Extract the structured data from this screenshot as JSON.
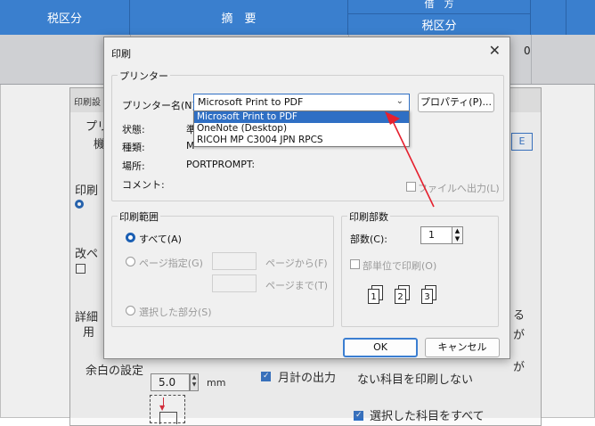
{
  "background_app": {
    "header": {
      "col1": "税区分",
      "col2": "摘　要",
      "col3_top": "借　方",
      "col3_bottom": "税区分"
    },
    "row_value": "0"
  },
  "settings_window": {
    "title": "印刷設",
    "labels": {
      "printer": "プリ",
      "model": "機",
      "print": "印刷",
      "page_break": "改ペ",
      "detail": "詳細",
      "detail2": "用",
      "margin": "余白の設定",
      "right1": "る",
      "right2": "が",
      "right3": "が",
      "monthly_total": "月計の出力",
      "no_print": "ない科目を印刷しない",
      "select_all": "選択した科目をすべて",
      "unit": "mm"
    },
    "margin_value": "5.0",
    "button_label": "E"
  },
  "print_dialog": {
    "title": "印刷",
    "printer_group": "プリンター",
    "printer_name_label": "プリンター名(N):",
    "printer_selected": "Microsoft Print to PDF",
    "properties_button": "プロパティ(P)...",
    "printer_options": [
      "Microsoft Print to PDF",
      "OneNote (Desktop)",
      "RICOH MP C3004 JPN RPCS"
    ],
    "status_label": "状態:",
    "status_value": "準",
    "type_label": "種類:",
    "type_value": "M",
    "location_label": "場所:",
    "location_value": "PORTPROMPT:",
    "comment_label": "コメント:",
    "print_to_file": "ファイルへ出力(L)",
    "range_group": "印刷範囲",
    "range_all": "すべて(A)",
    "range_pages": "ページ指定(G)",
    "page_from": "ページから(F)",
    "page_to": "ページまで(T)",
    "range_selection": "選択した部分(S)",
    "copies_group": "印刷部数",
    "copies_label": "部数(C):",
    "copies_value": "1",
    "collate_label": "部単位で印刷(O)",
    "collate_pages": [
      "1",
      "1",
      "2",
      "2",
      "3",
      "3"
    ],
    "ok_button": "OK",
    "cancel_button": "キャンセル"
  },
  "colors": {
    "header_blue": "#3a7fce",
    "accent": "#2f6fc4",
    "arrow_red": "#e5202e"
  }
}
